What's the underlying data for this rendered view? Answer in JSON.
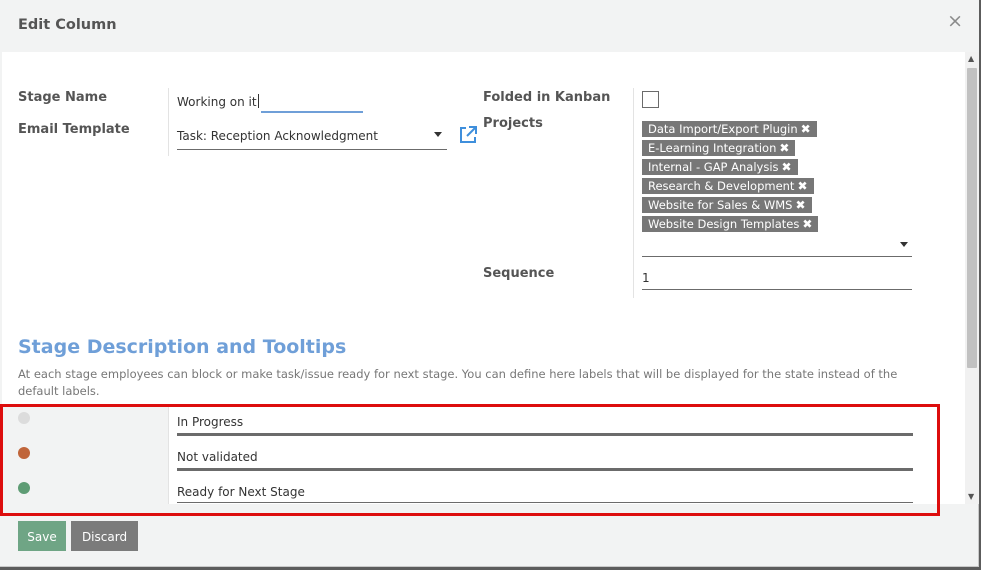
{
  "dialog": {
    "title": "Edit Column",
    "close_glyph": "×"
  },
  "form": {
    "stage_name": {
      "label": "Stage Name",
      "value": "Working on it"
    },
    "email_template": {
      "label": "Email Template",
      "value": "Task: Reception Acknowledgment"
    },
    "folded_in_kanban": {
      "label": "Folded in Kanban",
      "checked": false
    },
    "projects": {
      "label": "Projects",
      "tags": [
        "Data Import/Export Plugin",
        "E-Learning Integration",
        "Internal - GAP Analysis",
        "Research & Development",
        "Website for Sales & WMS",
        "Website Design Templates"
      ],
      "remove_glyph": "✖"
    },
    "sequence": {
      "label": "Sequence",
      "value": "1"
    }
  },
  "tooltips_section": {
    "title": "Stage Description and Tooltips",
    "help": "At each stage employees can block or make task/issue ready for next stage. You can define here labels that will be displayed for the state instead of the default labels.",
    "states": [
      {
        "label": "In Progress",
        "color": "#dcdcdc"
      },
      {
        "label": "Not validated",
        "color": "#c0653a"
      },
      {
        "label": "Ready for Next Stage",
        "color": "#5e9c74"
      }
    ]
  },
  "footer": {
    "save_label": "Save",
    "discard_label": "Discard"
  },
  "colors": {
    "accent": "#6f9fd8",
    "save": "#6fa585",
    "discard": "#7b7b7b",
    "tag": "#777777",
    "highlight": "#dd0d0d"
  },
  "icons": {
    "close": "close-icon",
    "external_link": "external-link-icon",
    "dropdown": "chevron-down-icon",
    "tag_remove": "remove-icon"
  }
}
